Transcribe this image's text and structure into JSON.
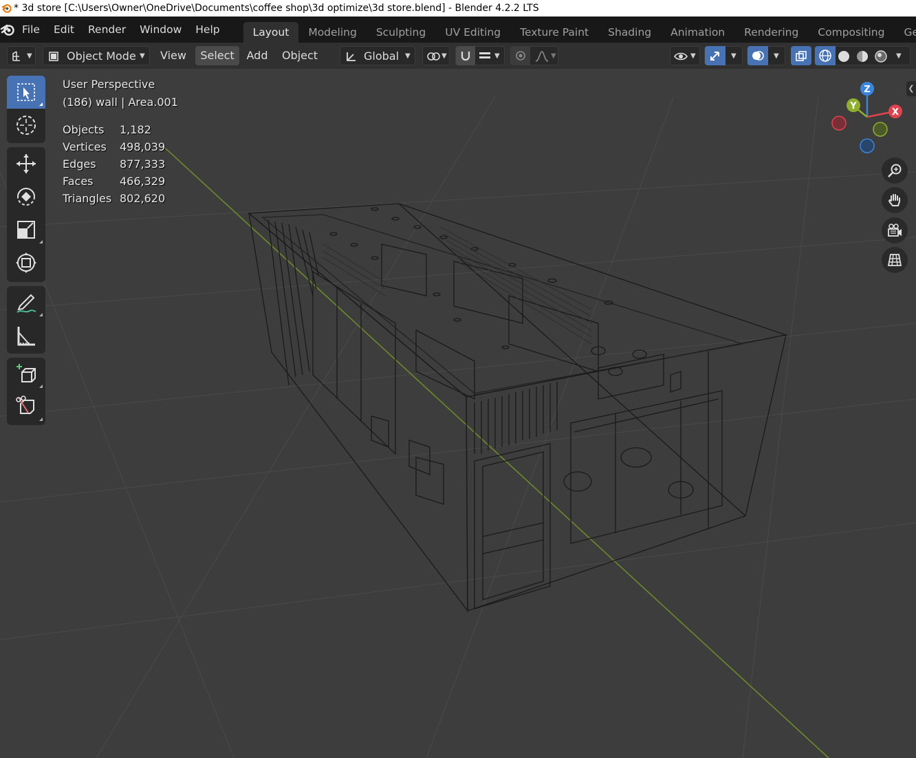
{
  "window": {
    "title": "* 3d store [C:\\Users\\Owner\\OneDrive\\Documents\\coffee shop\\3d optimize\\3d store.blend] - Blender 4.2.2 LTS"
  },
  "menu": {
    "items": [
      "File",
      "Edit",
      "Render",
      "Window",
      "Help"
    ]
  },
  "workspaces": {
    "tabs": [
      "Layout",
      "Modeling",
      "Sculpting",
      "UV Editing",
      "Texture Paint",
      "Shading",
      "Animation",
      "Rendering",
      "Compositing",
      "Geo"
    ],
    "active": "Layout"
  },
  "header": {
    "mode": "Object Mode",
    "view": "View",
    "select": "Select",
    "add": "Add",
    "object": "Object",
    "orientation": "Global"
  },
  "viewport": {
    "perspective": "User Perspective",
    "active_object": "(186) wall | Area.001",
    "stats": [
      {
        "label": "Objects",
        "value": "1,182"
      },
      {
        "label": "Vertices",
        "value": "498,039"
      },
      {
        "label": "Edges",
        "value": "877,333"
      },
      {
        "label": "Faces",
        "value": "466,329"
      },
      {
        "label": "Triangles",
        "value": "802,620"
      }
    ],
    "gizmo": {
      "x": "X",
      "y": "Y",
      "z": "Z"
    }
  },
  "colors": {
    "accent": "#4772b3",
    "axis_x": "#e0434f",
    "axis_y": "#8fb02f",
    "axis_z": "#3a86de",
    "y_axis_line": "#6b8a2a"
  },
  "tools": [
    "select-box-icon",
    "cursor-icon",
    "move-icon",
    "rotate-icon",
    "scale-icon",
    "transform-icon",
    "annotate-icon",
    "measure-icon",
    "add-cube-icon",
    "knife-icon"
  ]
}
